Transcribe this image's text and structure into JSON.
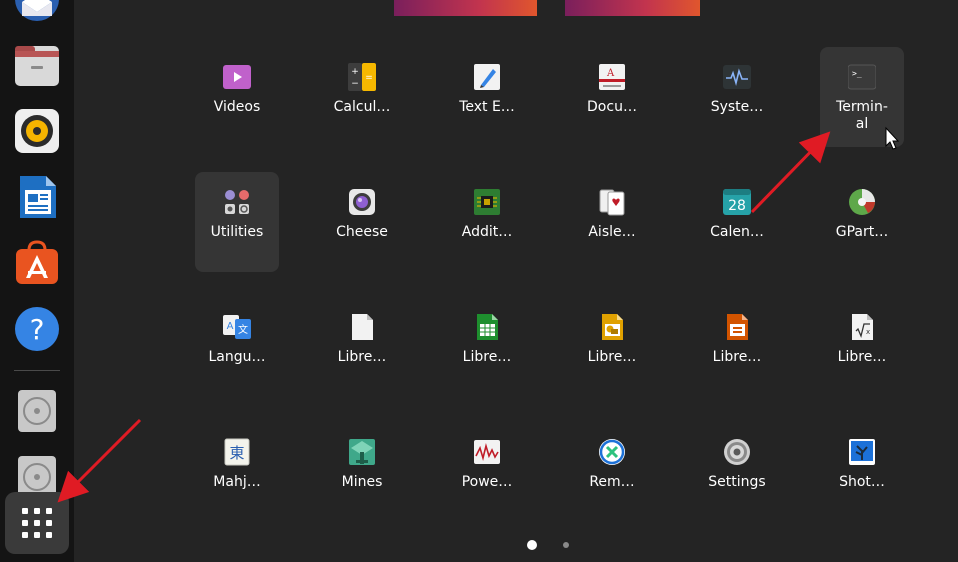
{
  "colors": {
    "background": "#242424",
    "dock": "#141414",
    "highlight": "#353535",
    "arrow": "#e01b24"
  },
  "dock": {
    "items": [
      {
        "name": "thunderbird-icon"
      },
      {
        "name": "files-icon"
      },
      {
        "name": "rhythmbox-icon"
      },
      {
        "name": "libreoffice-writer-icon"
      },
      {
        "name": "app-center-icon"
      },
      {
        "name": "help-icon"
      },
      {
        "name": "disc-drive-icon"
      },
      {
        "name": "disc-drive-icon-2"
      }
    ],
    "show_apps_icon": "grid-icon"
  },
  "apps": [
    {
      "label": "Videos",
      "icon": "videos-icon"
    },
    {
      "label": "Calcul…",
      "icon": "calculator-icon"
    },
    {
      "label": "Text E…",
      "icon": "text-editor-icon"
    },
    {
      "label": "Docu…",
      "icon": "document-viewer-icon"
    },
    {
      "label": "Syste…",
      "icon": "system-monitor-icon"
    },
    {
      "label": "Termin-\nal",
      "icon": "terminal-icon",
      "highlighted": true
    },
    {
      "label": "Utilities",
      "icon": "utilities-folder-icon",
      "highlighted": true
    },
    {
      "label": "Cheese",
      "icon": "cheese-icon"
    },
    {
      "label": "Addit…",
      "icon": "additional-drivers-icon"
    },
    {
      "label": "Aisle…",
      "icon": "aisleriot-icon"
    },
    {
      "label": "Calen…",
      "icon": "calendar-icon"
    },
    {
      "label": "GPart…",
      "icon": "gparted-icon"
    },
    {
      "label": "Langu…",
      "icon": "language-support-icon"
    },
    {
      "label": "Libre…",
      "icon": "libreoffice-icon"
    },
    {
      "label": "Libre…",
      "icon": "libreoffice-calc-icon"
    },
    {
      "label": "Libre…",
      "icon": "libreoffice-draw-icon"
    },
    {
      "label": "Libre…",
      "icon": "libreoffice-impress-icon"
    },
    {
      "label": "Libre…",
      "icon": "libreoffice-math-icon"
    },
    {
      "label": "Mahj…",
      "icon": "mahjongg-icon"
    },
    {
      "label": "Mines",
      "icon": "mines-icon"
    },
    {
      "label": "Powe…",
      "icon": "power-statistics-icon"
    },
    {
      "label": "Rem…",
      "icon": "remmina-icon"
    },
    {
      "label": "Settings",
      "icon": "settings-icon"
    },
    {
      "label": "Shot…",
      "icon": "shotwell-icon"
    }
  ],
  "calendar_day": "28",
  "pagination": {
    "pages": 2,
    "current": 1
  }
}
